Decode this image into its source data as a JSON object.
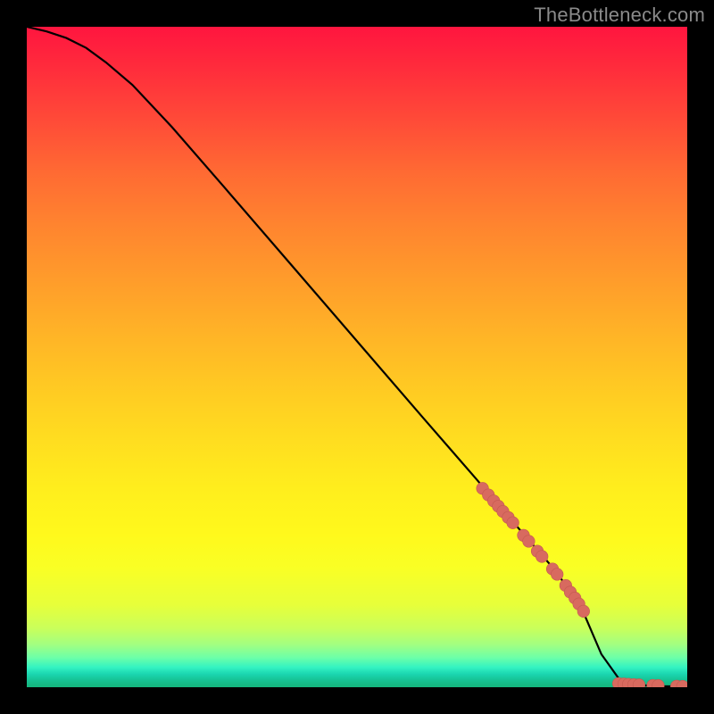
{
  "watermark": "TheBottleneck.com",
  "colors": {
    "background": "#000000",
    "curve": "#000000",
    "marker_fill": "#d86a5f",
    "marker_stroke": "#c45a50"
  },
  "chart_data": {
    "type": "line",
    "title": "",
    "xlabel": "",
    "ylabel": "",
    "xlim": [
      0,
      100
    ],
    "ylim": [
      0,
      100
    ],
    "grid": false,
    "legend": false,
    "series": [
      {
        "name": "bottleneck-curve",
        "comment": "Monotone decreasing curve; starts at top-left with gentle shoulder, descends roughly linearly, flattens to zero near x≈87 and stays at 0.",
        "x": [
          0,
          3,
          6,
          9,
          12,
          16,
          22,
          30,
          40,
          50,
          60,
          68,
          72,
          76,
          80,
          84,
          87,
          90,
          93,
          96,
          100
        ],
        "y": [
          100,
          99.3,
          98.3,
          96.8,
          94.6,
          91.2,
          84.8,
          75.6,
          64.0,
          52.4,
          40.8,
          31.6,
          26.9,
          22.3,
          17.7,
          12.0,
          5.0,
          0.8,
          0.3,
          0.15,
          0.1
        ]
      }
    ],
    "markers": [
      {
        "name": "descending-cluster",
        "comment": "Dense pink dots along the curve in the lower-right descending segment.",
        "points": [
          {
            "x": 69.0,
            "y": 30.1
          },
          {
            "x": 69.9,
            "y": 29.1
          },
          {
            "x": 70.7,
            "y": 28.2
          },
          {
            "x": 71.4,
            "y": 27.4
          },
          {
            "x": 72.1,
            "y": 26.6
          },
          {
            "x": 72.9,
            "y": 25.7
          },
          {
            "x": 73.6,
            "y": 24.9
          },
          {
            "x": 75.2,
            "y": 23.0
          },
          {
            "x": 76.0,
            "y": 22.1
          },
          {
            "x": 77.3,
            "y": 20.6
          },
          {
            "x": 78.0,
            "y": 19.8
          },
          {
            "x": 79.6,
            "y": 17.9
          },
          {
            "x": 80.3,
            "y": 17.1
          },
          {
            "x": 81.6,
            "y": 15.4
          },
          {
            "x": 82.3,
            "y": 14.4
          },
          {
            "x": 83.0,
            "y": 13.5
          },
          {
            "x": 83.6,
            "y": 12.6
          },
          {
            "x": 84.3,
            "y": 11.5
          }
        ]
      },
      {
        "name": "baseline-cluster",
        "comment": "Pink dots sitting on the flat zero baseline at the far right.",
        "points": [
          {
            "x": 89.6,
            "y": 0.55
          },
          {
            "x": 90.4,
            "y": 0.5
          },
          {
            "x": 91.1,
            "y": 0.45
          },
          {
            "x": 91.9,
            "y": 0.4
          },
          {
            "x": 92.7,
            "y": 0.36
          },
          {
            "x": 94.8,
            "y": 0.28
          },
          {
            "x": 95.6,
            "y": 0.25
          },
          {
            "x": 98.4,
            "y": 0.15
          },
          {
            "x": 99.3,
            "y": 0.12
          }
        ]
      }
    ]
  }
}
